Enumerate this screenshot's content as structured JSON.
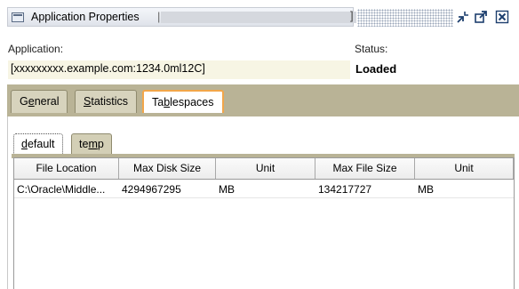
{
  "window": {
    "title": "Application Properties",
    "controls": {
      "restore_icon": "restore-icon",
      "maximize_icon": "maximize-icon",
      "close_icon": "close-icon"
    }
  },
  "application": {
    "label": "Application:",
    "value": "[xxxxxxxxx.example.com:1234.0ml12C]"
  },
  "status": {
    "label": "Status:",
    "value": "Loaded"
  },
  "tabs": [
    {
      "label": "General",
      "mnemonic": "e",
      "before": "G",
      "after": "neral",
      "active": false
    },
    {
      "label": "Statistics",
      "mnemonic": "S",
      "before": "",
      "after": "tatistics",
      "active": false
    },
    {
      "label": "Tablespaces",
      "mnemonic": "b",
      "before": "Ta",
      "after": "lespaces",
      "active": true
    }
  ],
  "subtabs": [
    {
      "label": "default",
      "mnemonic": "d",
      "before": "",
      "after": "efault",
      "active": true
    },
    {
      "label": "temp",
      "mnemonic": "m",
      "before": "te",
      "after": "p",
      "active": false
    }
  ],
  "table": {
    "columns": [
      "File Location",
      "Max Disk Size",
      "Unit",
      "Max File Size",
      "Unit"
    ],
    "rows": [
      [
        "C:\\Oracle\\Middle...",
        "4294967295",
        "MB",
        "134217727",
        "MB"
      ]
    ]
  },
  "colors": {
    "tabbar_bg": "#b9b396",
    "active_tab_border": "#f2a64a",
    "value_bg": "#f7f5e4"
  }
}
